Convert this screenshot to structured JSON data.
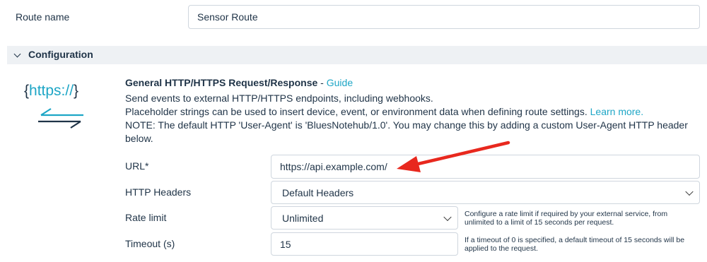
{
  "route_name": {
    "label": "Route name",
    "value": "Sensor Route"
  },
  "configuration": {
    "section_title": "Configuration"
  },
  "endpoint": {
    "logo_text": "https://",
    "title": "General HTTP/HTTPS Request/Response",
    "title_separator": " - ",
    "guide_link": "Guide",
    "description_line1": "Send events to external HTTP/HTTPS endpoints, including webhooks.",
    "description_line2": "Placeholder strings can be used to insert device, event, or environment data when defining route settings.",
    "learn_more_link": "Learn more.",
    "note_line1": "NOTE: The default HTTP 'User-Agent' is 'BluesNotehub/1.0'. You may change this by adding a custom User-Agent HTTP header",
    "note_line2": "below."
  },
  "url_field": {
    "label": "URL*",
    "value": "https://api.example.com/"
  },
  "http_headers": {
    "label": "HTTP Headers",
    "selected": "Default Headers"
  },
  "rate_limit": {
    "label": "Rate limit",
    "selected": "Unlimited",
    "help_line1": "Configure a rate limit if required by your external service, from",
    "help_line2": "unlimited to a limit of 15 seconds per request."
  },
  "timeout": {
    "label": "Timeout (s)",
    "value": "15",
    "help_line1": "If a timeout of 0 is specified, a default timeout of 15 seconds will be",
    "help_line2": "applied to the request."
  },
  "colors": {
    "accent_link": "#1ea6c6",
    "annotation_arrow": "#e8281e",
    "section_bar": "#eef1f4"
  }
}
